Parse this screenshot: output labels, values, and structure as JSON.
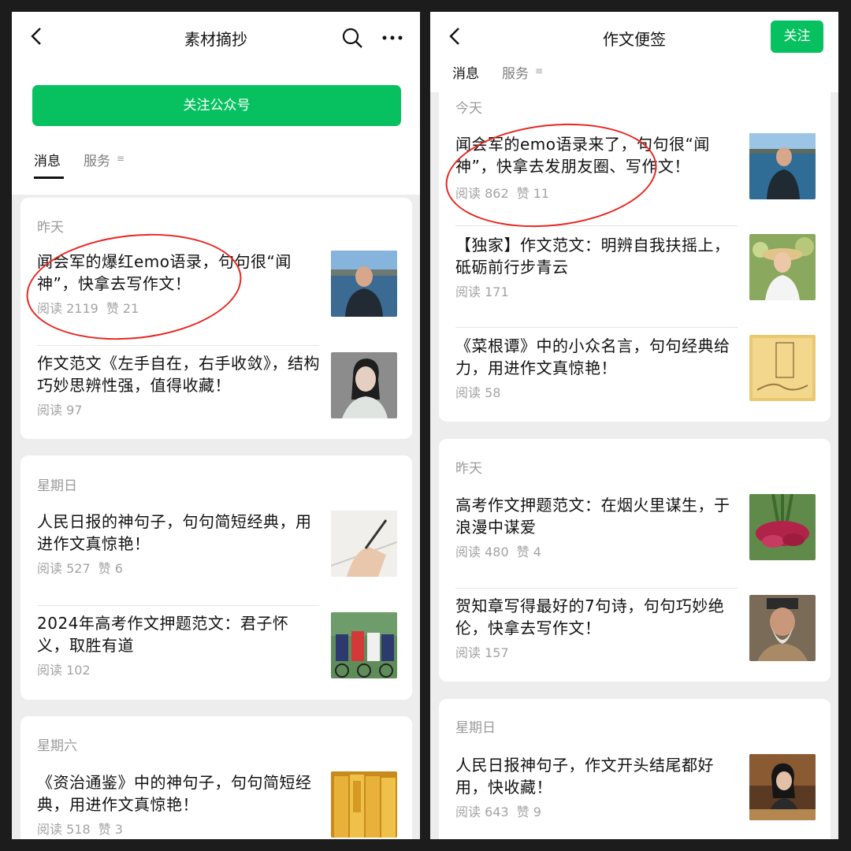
{
  "left": {
    "title": "素材摘抄",
    "follow_button": "关注公众号",
    "tabs": [
      "消息",
      "服务"
    ],
    "sections": [
      {
        "date": "昨天",
        "articles": [
          {
            "title": "闻会军的爆红emo语录，句句很“闻神”，快拿去写作文！",
            "reads": "阅读 2119",
            "likes": "赞 21",
            "thumb": "man-by-lake-photo"
          },
          {
            "title": "作文范文《左手自在，右手收敛》，结构巧妙思辨性强，值得收藏！",
            "reads": "阅读 97",
            "likes": "",
            "thumb": "woman-portrait-photo"
          }
        ]
      },
      {
        "date": "星期日",
        "articles": [
          {
            "title": "人民日报的神句子，句句简短经典，用进作文真惊艳！",
            "reads": "阅读 527",
            "likes": "赞 6",
            "thumb": "hand-writing-photo"
          },
          {
            "title": "2024年高考作文押题范文：君子怀义，取胜有道",
            "reads": "阅读 102",
            "likes": "",
            "thumb": "cycling-race-photo"
          }
        ]
      },
      {
        "date": "星期六",
        "articles": [
          {
            "title": "《资治通鉴》中的神句子，句句简短经典，用进作文真惊艳！",
            "reads": "阅读 518",
            "likes": "赞 3",
            "thumb": "zizhi-tongjian-books-photo"
          }
        ]
      }
    ]
  },
  "right": {
    "title": "作文便签",
    "follow_button": "关注",
    "tabs": [
      "消息",
      "服务"
    ],
    "sections": [
      {
        "date": "今天",
        "articles": [
          {
            "title": "闻会军的emo语录来了，句句很“闻神”，快拿去发朋友圈、写作文！",
            "reads": "阅读 862",
            "likes": "赞 11",
            "thumb": "man-by-lake-photo"
          },
          {
            "title": "【独家】作文范文：明辨自我扶摇上，砥砺前行步青云",
            "reads": "阅读 171",
            "likes": "",
            "thumb": "girl-straw-hat-photo"
          },
          {
            "title": "《菜根谭》中的小众名言，句句经典给力，用进作文真惊艳！",
            "reads": "阅读 58",
            "likes": "",
            "thumb": "caigentan-book-cover"
          }
        ]
      },
      {
        "date": "昨天",
        "articles": [
          {
            "title": "高考作文押题范文：在烟火里谋生，于浪漫中谋爱",
            "reads": "阅读 480",
            "likes": "赞 4",
            "thumb": "radish-bunch-photo"
          },
          {
            "title": "贺知章写得最好的7句诗，句句巧妙绝伦，快拿去写作文！",
            "reads": "阅读 157",
            "likes": "",
            "thumb": "old-poet-photo"
          }
        ]
      },
      {
        "date": "星期日",
        "articles": [
          {
            "title": "人民日报神句子，作文开头结尾都好用，快收藏！",
            "reads": "阅读 643",
            "likes": "赞 9",
            "thumb": "woman-reading-photo"
          }
        ]
      }
    ]
  },
  "colors": {
    "accent_green": "#07c160",
    "annotation_red": "#e8261f",
    "meta_gray": "#a3a3a3"
  }
}
